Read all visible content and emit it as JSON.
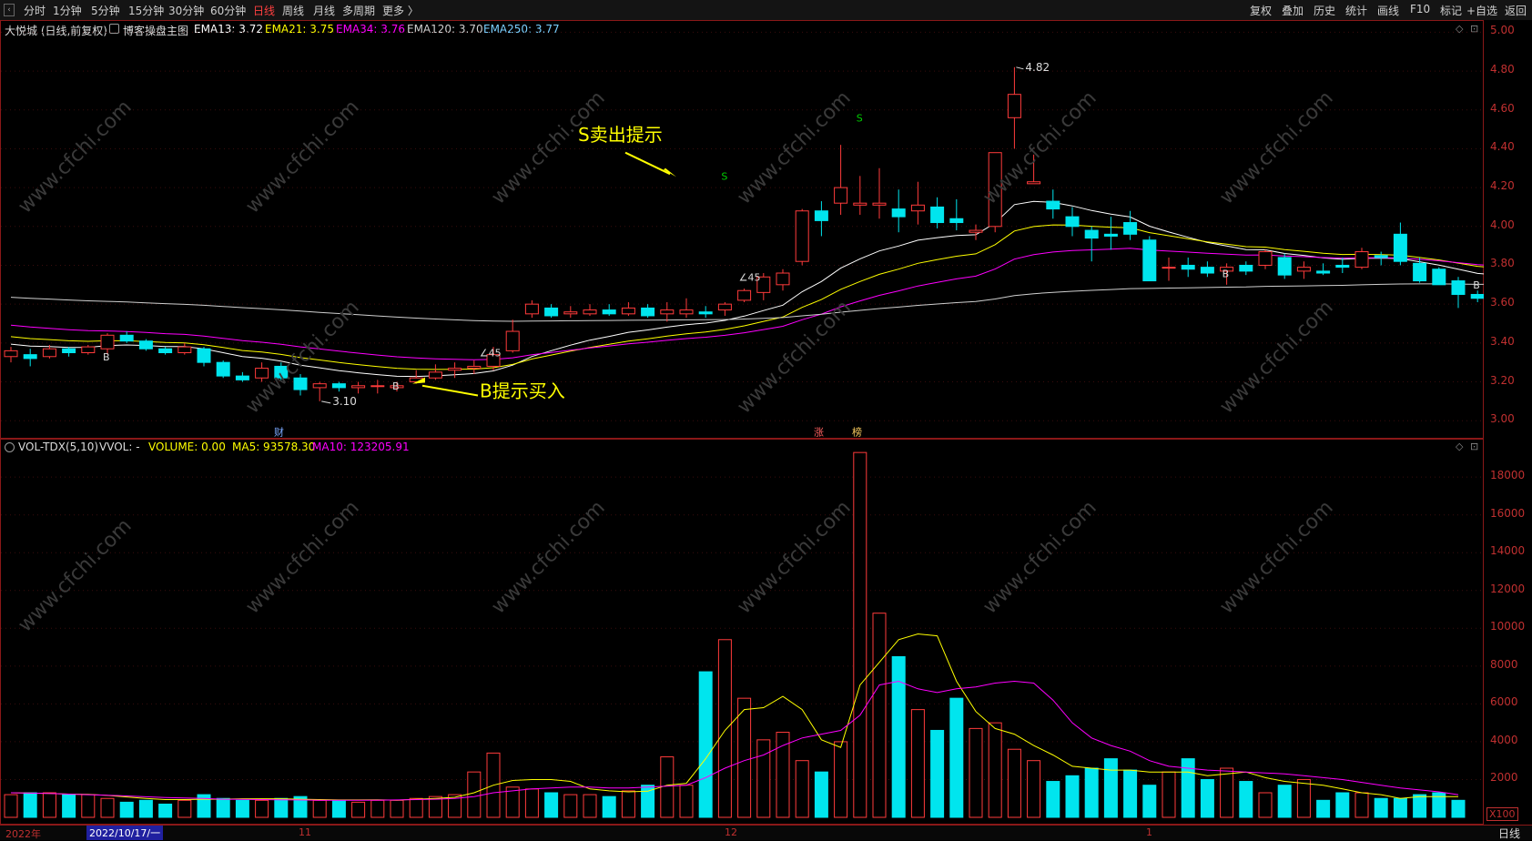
{
  "toolbar": {
    "periods": [
      "分时",
      "1分钟",
      "5分钟",
      "15分钟",
      "30分钟",
      "60分钟",
      "日线",
      "周线",
      "月线",
      "多周期",
      "更多 〉"
    ],
    "active_period": "日线",
    "right_buttons": [
      "复权",
      "叠加",
      "历史",
      "统计",
      "画线",
      "F10",
      "标记",
      "+自选",
      "返回"
    ]
  },
  "colors": {
    "up": "#ff3b3b",
    "down": "#00e5ee",
    "ema13": "#ffffff",
    "ema21": "#ffff00",
    "ema34": "#ff00ff",
    "ema120": "#cfcfcf",
    "ema250": "#7ad0ff",
    "axis": "#c03030",
    "annotation": "#ffff00"
  },
  "main_panel": {
    "title": "大悦城 (日线,前复权)",
    "indicator_name": "博客操盘主图",
    "ema13_text": "EMA13: 3.72",
    "ema21_text": "EMA21: 3.75",
    "ema34_text": "EMA34: 3.76",
    "ema120_text": "EMA120: 3.70",
    "ema250_text": "EMA250: 3.77",
    "high_label": "4.82",
    "low_label": "3.10",
    "angle_label_1": "∠45",
    "angle_label_2": "∠45",
    "sell_annotation": "S卖出提示",
    "buy_annotation": "B提示买入",
    "signal_b": "B",
    "signal_s": "S",
    "event_cai": "财",
    "event_zhang": "涨",
    "event_bang": "榜"
  },
  "vol_panel": {
    "title": "VOL-TDX(5,10)",
    "vvol": "VVOL: -",
    "volume_text": "VOLUME: 0.00",
    "ma5_text": "MA5: 93578.30",
    "ma10_text": "MA10: 123205.91",
    "unit_label": "X100"
  },
  "bottom": {
    "year": "2022年",
    "cursor_date": "2022/10/17/一",
    "m11": "11",
    "m12": "12",
    "m1": "1",
    "period_button": "日线"
  },
  "watermark": "www.cfchi.com",
  "chart_data": {
    "type": "candlestick",
    "price_axis": {
      "ticks": [
        3.0,
        3.2,
        3.4,
        3.6,
        3.8,
        4.0,
        4.2,
        4.4,
        4.6,
        4.8,
        5.0
      ],
      "ylim": [
        2.94,
        5.03
      ]
    },
    "volume_axis": {
      "ticks": [
        2000,
        4000,
        6000,
        8000,
        10000,
        12000,
        14000,
        16000,
        18000
      ],
      "ylim": [
        0,
        19500
      ]
    },
    "candles": [
      [
        3.33,
        3.36,
        3.3,
        3.38
      ],
      [
        3.34,
        3.32,
        3.28,
        3.37
      ],
      [
        3.33,
        3.37,
        3.32,
        3.39
      ],
      [
        3.37,
        3.35,
        3.33,
        3.38
      ],
      [
        3.35,
        3.38,
        3.34,
        3.39
      ],
      [
        3.37,
        3.44,
        3.34,
        3.45
      ],
      [
        3.44,
        3.41,
        3.4,
        3.46
      ],
      [
        3.41,
        3.37,
        3.36,
        3.42
      ],
      [
        3.37,
        3.35,
        3.34,
        3.38
      ],
      [
        3.35,
        3.38,
        3.34,
        3.4
      ],
      [
        3.37,
        3.3,
        3.28,
        3.38
      ],
      [
        3.3,
        3.23,
        3.22,
        3.31
      ],
      [
        3.23,
        3.21,
        3.2,
        3.25
      ],
      [
        3.22,
        3.27,
        3.2,
        3.3
      ],
      [
        3.28,
        3.22,
        3.21,
        3.3
      ],
      [
        3.22,
        3.16,
        3.13,
        3.24
      ],
      [
        3.17,
        3.19,
        3.1,
        3.2
      ],
      [
        3.19,
        3.17,
        3.15,
        3.2
      ],
      [
        3.17,
        3.18,
        3.14,
        3.2
      ],
      [
        3.18,
        3.18,
        3.14,
        3.21
      ],
      [
        3.17,
        3.18,
        3.15,
        3.2
      ],
      [
        3.2,
        3.22,
        3.19,
        3.26
      ],
      [
        3.22,
        3.25,
        3.21,
        3.29
      ],
      [
        3.26,
        3.27,
        3.22,
        3.3
      ],
      [
        3.27,
        3.28,
        3.24,
        3.31
      ],
      [
        3.28,
        3.34,
        3.26,
        3.38
      ],
      [
        3.36,
        3.46,
        3.35,
        3.52
      ],
      [
        3.55,
        3.6,
        3.53,
        3.62
      ],
      [
        3.58,
        3.54,
        3.53,
        3.6
      ],
      [
        3.55,
        3.56,
        3.53,
        3.59
      ],
      [
        3.55,
        3.57,
        3.54,
        3.6
      ],
      [
        3.57,
        3.55,
        3.54,
        3.6
      ],
      [
        3.55,
        3.58,
        3.54,
        3.61
      ],
      [
        3.58,
        3.54,
        3.53,
        3.6
      ],
      [
        3.55,
        3.57,
        3.51,
        3.61
      ],
      [
        3.55,
        3.57,
        3.53,
        3.63
      ],
      [
        3.56,
        3.55,
        3.53,
        3.59
      ],
      [
        3.57,
        3.6,
        3.54,
        3.61
      ],
      [
        3.62,
        3.67,
        3.61,
        3.68
      ],
      [
        3.66,
        3.74,
        3.62,
        3.76
      ],
      [
        3.7,
        3.76,
        3.67,
        3.78
      ],
      [
        3.82,
        4.08,
        3.8,
        4.09
      ],
      [
        4.08,
        4.03,
        3.95,
        4.13
      ],
      [
        4.12,
        4.2,
        4.06,
        4.42
      ],
      [
        4.11,
        4.12,
        4.06,
        4.26
      ],
      [
        4.11,
        4.12,
        4.04,
        4.3
      ],
      [
        4.09,
        4.05,
        3.97,
        4.19
      ],
      [
        4.08,
        4.11,
        4.01,
        4.23
      ],
      [
        4.1,
        4.02,
        3.99,
        4.15
      ],
      [
        4.04,
        4.02,
        3.98,
        4.14
      ],
      [
        3.97,
        3.98,
        3.93,
        4.01
      ],
      [
        4.0,
        4.38,
        3.97,
        4.38
      ],
      [
        4.56,
        4.68,
        4.4,
        4.82
      ],
      [
        4.22,
        4.23,
        4.22,
        4.37
      ],
      [
        4.13,
        4.09,
        4.04,
        4.19
      ],
      [
        4.05,
        4.0,
        3.95,
        4.1
      ],
      [
        3.98,
        3.94,
        3.82,
        4.0
      ],
      [
        3.96,
        3.95,
        3.88,
        4.05
      ],
      [
        4.02,
        3.96,
        3.93,
        4.08
      ],
      [
        3.93,
        3.72,
        3.72,
        3.95
      ],
      [
        3.79,
        3.79,
        3.72,
        3.84
      ],
      [
        3.8,
        3.78,
        3.74,
        3.84
      ],
      [
        3.79,
        3.76,
        3.74,
        3.82
      ],
      [
        3.77,
        3.79,
        3.7,
        3.81
      ],
      [
        3.8,
        3.77,
        3.75,
        3.82
      ],
      [
        3.8,
        3.87,
        3.78,
        3.88
      ],
      [
        3.84,
        3.75,
        3.73,
        3.86
      ],
      [
        3.77,
        3.79,
        3.73,
        3.82
      ],
      [
        3.77,
        3.76,
        3.75,
        3.81
      ],
      [
        3.8,
        3.79,
        3.76,
        3.84
      ],
      [
        3.79,
        3.87,
        3.78,
        3.89
      ],
      [
        3.85,
        3.84,
        3.8,
        3.87
      ],
      [
        3.96,
        3.82,
        3.8,
        4.02
      ],
      [
        3.81,
        3.72,
        3.71,
        3.84
      ],
      [
        3.78,
        3.7,
        3.7,
        3.79
      ],
      [
        3.72,
        3.65,
        3.58,
        3.74
      ],
      [
        3.65,
        3.63,
        3.61,
        3.67
      ],
      [
        3.64,
        3.7,
        3.62,
        3.71
      ],
      [
        3.69,
        3.68,
        3.62,
        3.7
      ],
      [
        3.68,
        3.68,
        3.65,
        3.71
      ],
      [
        3.7,
        3.66,
        3.63,
        3.72
      ],
      [
        3.67,
        3.68,
        3.65,
        3.71
      ],
      [
        3.7,
        3.69,
        3.68,
        3.72
      ]
    ],
    "volume": [
      1200,
      1300,
      1300,
      1200,
      1200,
      1000,
      800,
      900,
      700,
      900,
      1200,
      1000,
      900,
      900,
      1000,
      1100,
      900,
      900,
      800,
      900,
      900,
      1000,
      1100,
      1200,
      2400,
      3400,
      1600,
      1500,
      1300,
      1200,
      1200,
      1100,
      1400,
      1700,
      3200,
      1700,
      7700,
      9400,
      6300,
      4100,
      4500,
      3000,
      2400,
      4000,
      19300,
      10800,
      8500,
      5700,
      4600,
      6300,
      4700,
      5000,
      3600,
      3000,
      1900,
      2200,
      2600,
      3100,
      2500,
      1700,
      2400,
      3100,
      2000,
      2600,
      1900,
      1300,
      1700,
      2000,
      900,
      1300,
      1300,
      1000,
      1000,
      1200,
      1300,
      900
    ],
    "ma5": [
      1300,
      1280,
      1260,
      1230,
      1220,
      1160,
      1080,
      1000,
      940,
      940,
      960,
      960,
      980,
      980,
      980,
      960,
      940,
      920,
      920,
      930,
      910,
      960,
      1000,
      1060,
      1300,
      1700,
      1950,
      2000,
      2000,
      1900,
      1500,
      1400,
      1350,
      1380,
      1700,
      1800,
      3100,
      4600,
      5700,
      5800,
      6400,
      5700,
      4100,
      3700,
      7000,
      8200,
      9400,
      9700,
      9600,
      7200,
      5600,
      4700,
      4400,
      3800,
      3300,
      2700,
      2600,
      2500,
      2500,
      2400,
      2400,
      2400,
      2200,
      2300,
      2400,
      2100,
      1900,
      1800,
      1700,
      1500,
      1300,
      1200,
      1000,
      1100,
      1100,
      1100
    ],
    "ma10": [
      1300,
      1280,
      1260,
      1230,
      1200,
      1170,
      1130,
      1090,
      1050,
      1020,
      1000,
      960,
      950,
      940,
      930,
      920,
      900,
      900,
      900,
      910,
      920,
      940,
      960,
      1000,
      1100,
      1300,
      1400,
      1500,
      1550,
      1600,
      1600,
      1550,
      1550,
      1600,
      1650,
      1700,
      2100,
      2600,
      3000,
      3300,
      3800,
      4200,
      4400,
      4600,
      5400,
      7000,
      7200,
      6800,
      6600,
      6800,
      6900,
      7100,
      7200,
      7100,
      6200,
      5000,
      4200,
      3800,
      3500,
      3000,
      2700,
      2600,
      2500,
      2450,
      2400,
      2350,
      2300,
      2200,
      2100,
      2000,
      1850,
      1700,
      1550,
      1450,
      1350,
      1200
    ]
  }
}
